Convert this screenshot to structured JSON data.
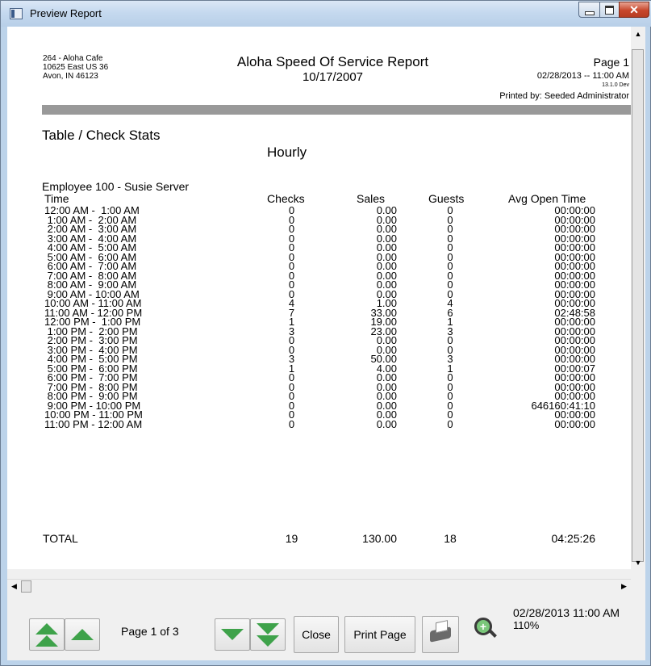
{
  "window": {
    "title": "Preview Report"
  },
  "report": {
    "store_number_name": "264 - Aloha Cafe",
    "store_address": "10625 East US 36",
    "store_city": "Avon, IN 46123",
    "title": "Aloha Speed Of Service Report",
    "business_date": "10/17/2007",
    "page": "Page 1",
    "generated": "02/28/2013 -- 11:00 AM",
    "version": "13.1.0 Dev",
    "printed_by": "Printed by: Seeded Administrator",
    "section": "Table / Check Stats",
    "subsection": "Hourly",
    "employee": "Employee 100 - Susie Server",
    "columns": {
      "time": "Time",
      "checks": "Checks",
      "sales": "Sales",
      "guests": "Guests",
      "avg_open": "Avg Open Time"
    },
    "rows": [
      {
        "time": "12:00 AM -  1:00 AM",
        "checks": "0",
        "sales": "0.00",
        "guests": "0",
        "avg_open": "00:00:00"
      },
      {
        "time": " 1:00 AM -  2:00 AM",
        "checks": "0",
        "sales": "0.00",
        "guests": "0",
        "avg_open": "00:00:00"
      },
      {
        "time": " 2:00 AM -  3:00 AM",
        "checks": "0",
        "sales": "0.00",
        "guests": "0",
        "avg_open": "00:00:00"
      },
      {
        "time": " 3:00 AM -  4:00 AM",
        "checks": "0",
        "sales": "0.00",
        "guests": "0",
        "avg_open": "00:00:00"
      },
      {
        "time": " 4:00 AM -  5:00 AM",
        "checks": "0",
        "sales": "0.00",
        "guests": "0",
        "avg_open": "00:00:00"
      },
      {
        "time": " 5:00 AM -  6:00 AM",
        "checks": "0",
        "sales": "0.00",
        "guests": "0",
        "avg_open": "00:00:00"
      },
      {
        "time": " 6:00 AM -  7:00 AM",
        "checks": "0",
        "sales": "0.00",
        "guests": "0",
        "avg_open": "00:00:00"
      },
      {
        "time": " 7:00 AM -  8:00 AM",
        "checks": "0",
        "sales": "0.00",
        "guests": "0",
        "avg_open": "00:00:00"
      },
      {
        "time": " 8:00 AM -  9:00 AM",
        "checks": "0",
        "sales": "0.00",
        "guests": "0",
        "avg_open": "00:00:00"
      },
      {
        "time": " 9:00 AM - 10:00 AM",
        "checks": "0",
        "sales": "0.00",
        "guests": "0",
        "avg_open": "00:00:00"
      },
      {
        "time": "10:00 AM - 11:00 AM",
        "checks": "4",
        "sales": "1.00",
        "guests": "4",
        "avg_open": "00:00:00"
      },
      {
        "time": "11:00 AM - 12:00 PM",
        "checks": "7",
        "sales": "33.00",
        "guests": "6",
        "avg_open": "02:48:58"
      },
      {
        "time": "12:00 PM -  1:00 PM",
        "checks": "1",
        "sales": "19.00",
        "guests": "1",
        "avg_open": "00:00:00"
      },
      {
        "time": " 1:00 PM -  2:00 PM",
        "checks": "3",
        "sales": "23.00",
        "guests": "3",
        "avg_open": "00:00:00"
      },
      {
        "time": " 2:00 PM -  3:00 PM",
        "checks": "0",
        "sales": "0.00",
        "guests": "0",
        "avg_open": "00:00:00"
      },
      {
        "time": " 3:00 PM -  4:00 PM",
        "checks": "0",
        "sales": "0.00",
        "guests": "0",
        "avg_open": "00:00:00"
      },
      {
        "time": " 4:00 PM -  5:00 PM",
        "checks": "3",
        "sales": "50.00",
        "guests": "3",
        "avg_open": "00:00:00"
      },
      {
        "time": " 5:00 PM -  6:00 PM",
        "checks": "1",
        "sales": "4.00",
        "guests": "1",
        "avg_open": "00:00:07"
      },
      {
        "time": " 6:00 PM -  7:00 PM",
        "checks": "0",
        "sales": "0.00",
        "guests": "0",
        "avg_open": "00:00:00"
      },
      {
        "time": " 7:00 PM -  8:00 PM",
        "checks": "0",
        "sales": "0.00",
        "guests": "0",
        "avg_open": "00:00:00"
      },
      {
        "time": " 8:00 PM -  9:00 PM",
        "checks": "0",
        "sales": "0.00",
        "guests": "0",
        "avg_open": "00:00:00"
      },
      {
        "time": " 9:00 PM - 10:00 PM",
        "checks": "0",
        "sales": "0.00",
        "guests": "0",
        "avg_open": "646160:41:10"
      },
      {
        "time": "10:00 PM - 11:00 PM",
        "checks": "0",
        "sales": "0.00",
        "guests": "0",
        "avg_open": "00:00:00"
      },
      {
        "time": "11:00 PM - 12:00 AM",
        "checks": "0",
        "sales": "0.00",
        "guests": "0",
        "avg_open": "00:00:00"
      }
    ],
    "total": {
      "label": "TOTAL",
      "checks": "19",
      "sales": "130.00",
      "guests": "18",
      "avg_open": "04:25:26"
    }
  },
  "toolbar": {
    "first_page_icon": "double-up-arrow-icon",
    "prev_page_icon": "up-arrow-icon",
    "page_label": "Page 1 of 3",
    "next_page_icon": "down-arrow-icon",
    "last_page_icon": "double-down-arrow-icon",
    "close_label": "Close",
    "print_page_label": "Print Page",
    "print_icon": "printer-icon",
    "zoom_icon": "zoom-in-icon",
    "status_datetime": "02/28/2013 11:00 AM",
    "zoom_level": "110%"
  },
  "colors": {
    "arrow_green": "#3ea24a",
    "rule_gray": "#999999",
    "close_red": "#c7472c"
  }
}
